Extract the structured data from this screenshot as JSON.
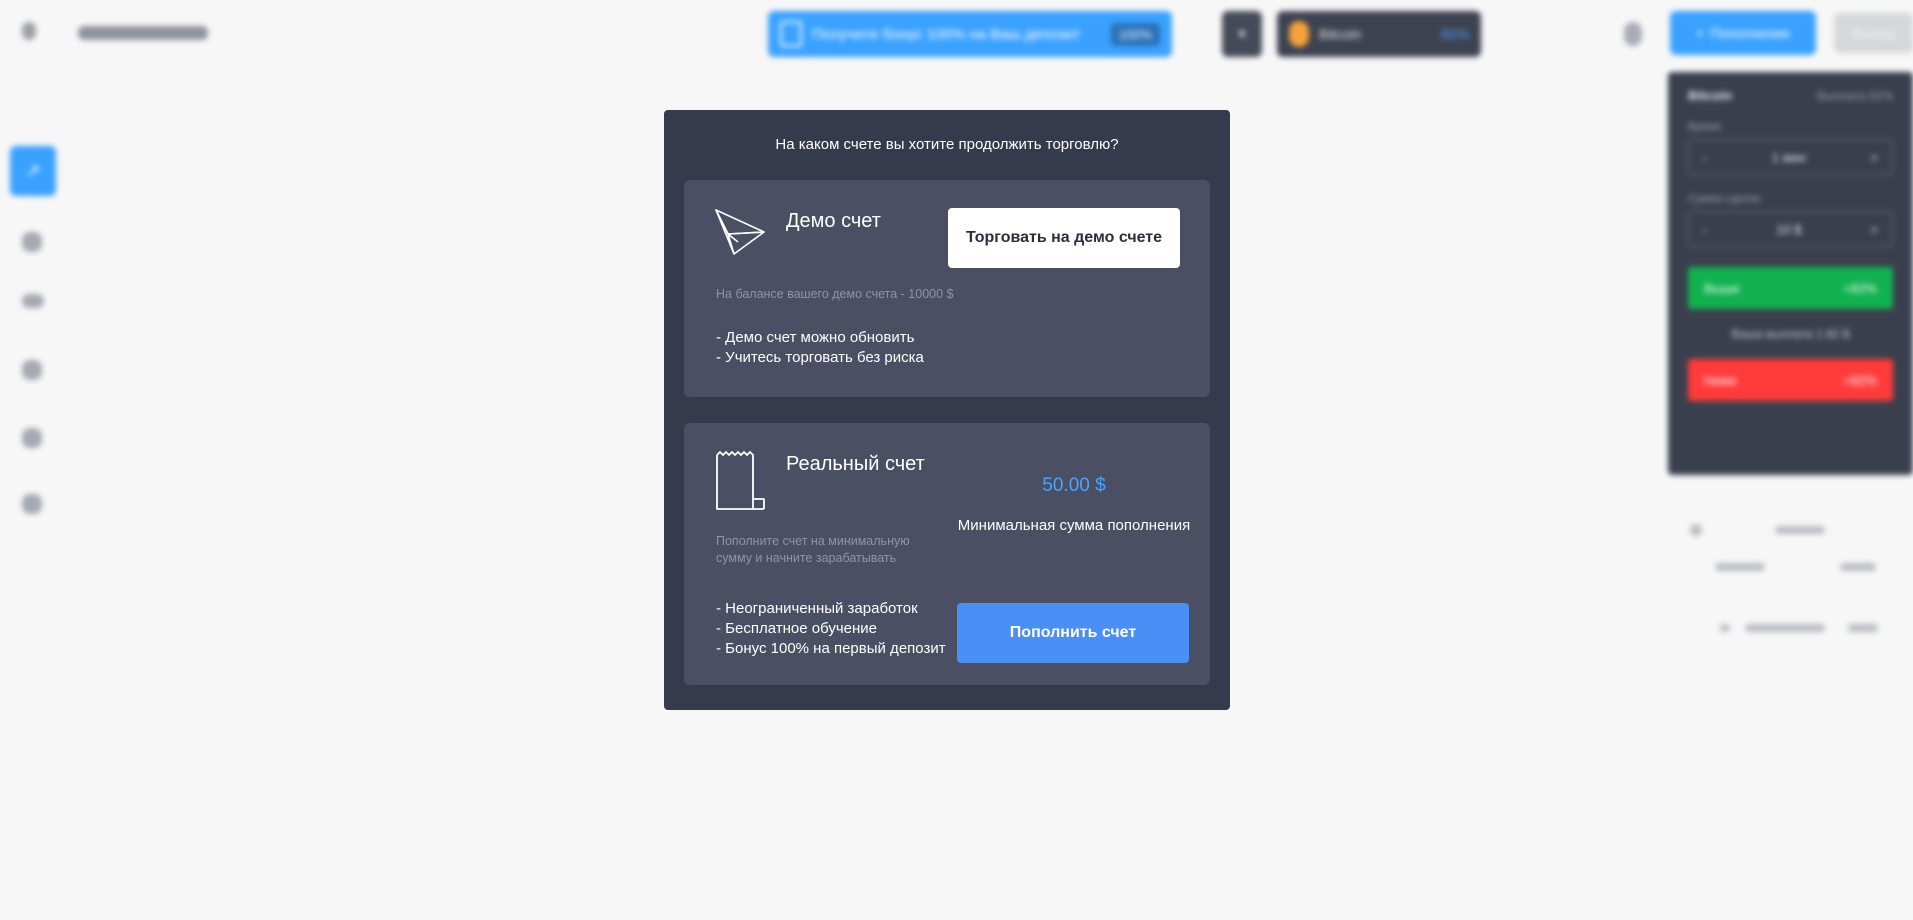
{
  "header": {
    "promo_label": "Получите бонус 100% на Ваш депозит",
    "promo_badge": "100%",
    "account_name": "Bitcoin",
    "account_pct": "82%",
    "deposit_label": "Пополнение",
    "exit_label": "Выход"
  },
  "trade_panel": {
    "asset": "Bitcoin",
    "payout": "Выплата 82%",
    "time_label": "Время",
    "time_value": "1 мин",
    "amount_label": "Сумма сделки",
    "amount_value": "10 $",
    "up_label": "Выше",
    "up_pct": "+82%",
    "payout_line": "Ваша выплата 1.82 $",
    "down_label": "Ниже",
    "down_pct": "+82%",
    "minus": "-",
    "plus": "+"
  },
  "modal": {
    "title": "На каком счете вы хотите продолжить торговлю?",
    "demo": {
      "heading": "Демо счет",
      "button": "Торговать на демо счете",
      "balance": "На балансе вашего демо счета - 10000 $",
      "bullets": [
        "- Демо счет можно обновить",
        "- Учитесь торговать без риска"
      ]
    },
    "real": {
      "heading": "Реальный счет",
      "amount": "50.00 $",
      "amount_label": "Минимальная сумма пополнения",
      "description": [
        "Пополните счет на минимальную",
        "сумму и начните зарабатывать"
      ],
      "bullets": [
        "- Неограниченный заработок",
        "- Бесплатное обучение",
        "- Бонус 100% на первый депозит"
      ],
      "button": "Пополнить счет"
    }
  }
}
